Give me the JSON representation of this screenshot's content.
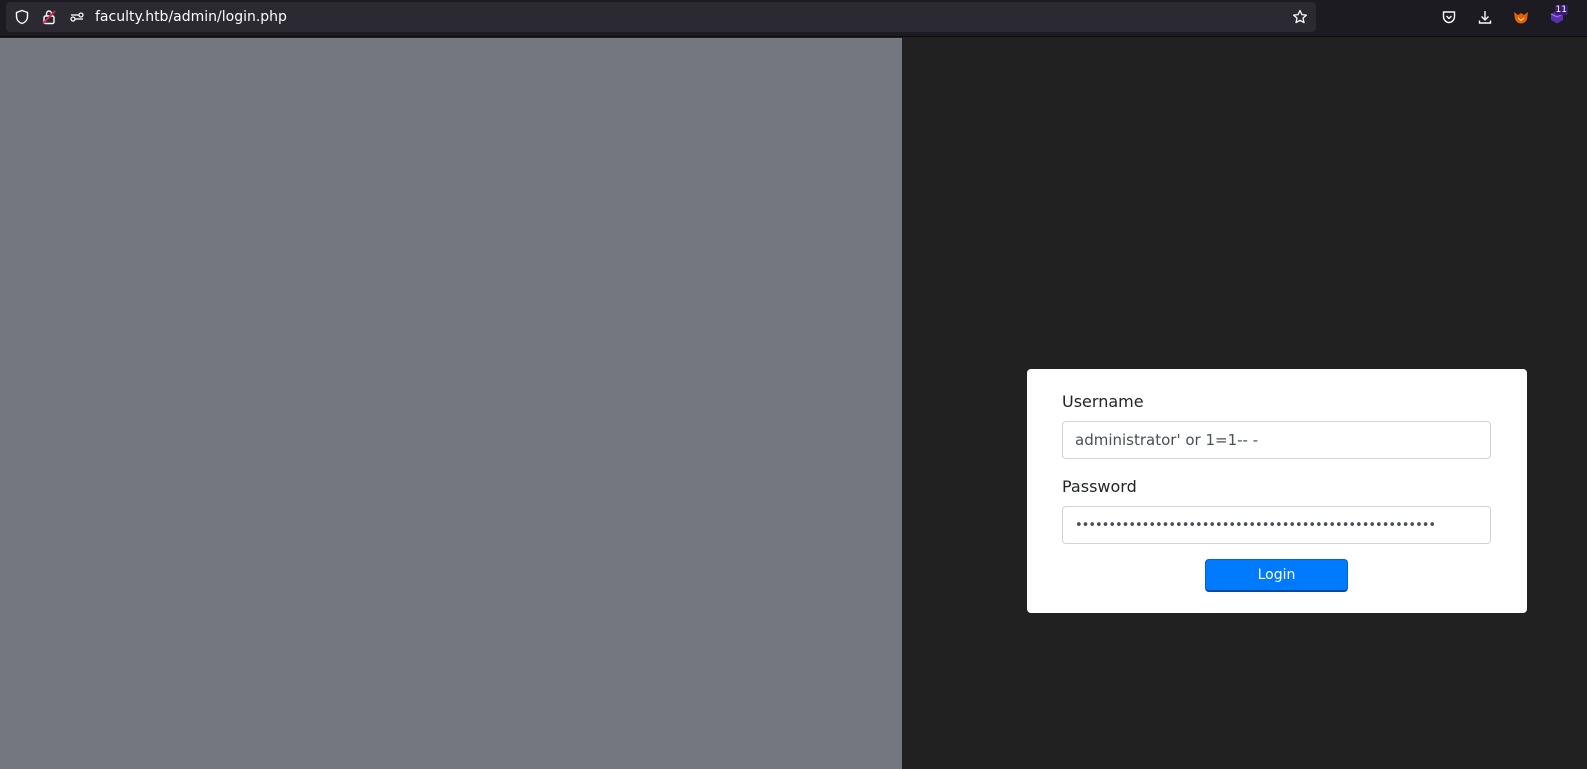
{
  "browser": {
    "url": "faculty.htb/admin/login.php",
    "extension_badge": "11",
    "icons": {
      "tracking": "shield-icon",
      "lock": "insecure-lock-icon",
      "permissions": "permissions-icon",
      "bookmark": "star-icon",
      "pocket": "pocket-icon",
      "downloads": "download-icon",
      "foxyproxy": "fox-extension-icon",
      "extension": "extension-icon"
    }
  },
  "page": {
    "left_panel_color": "#74777f",
    "right_panel_color": "#212121"
  },
  "login_form": {
    "username_label": "Username",
    "username_value": "administrator' or 1=1-- -",
    "password_label": "Password",
    "password_value": "••••••••••••••••••••••••••••••••••••••••••••••••••••••",
    "login_button": "Login",
    "button_color": "#007bff"
  }
}
